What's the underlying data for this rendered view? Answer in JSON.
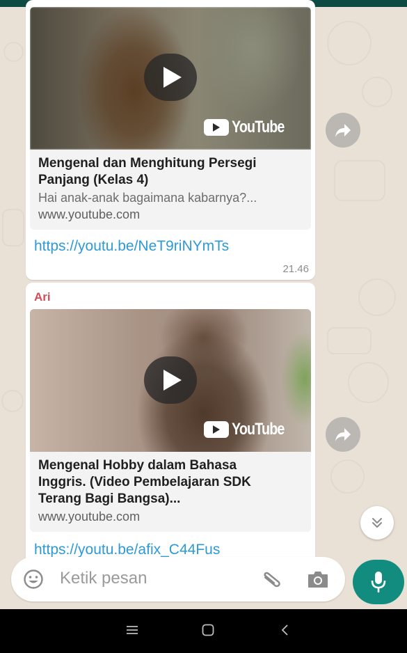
{
  "messages": [
    {
      "sender": "",
      "preview": {
        "title": "Mengenal dan Menghitung Persegi Panjang (Kelas 4)",
        "description": "Hai anak-anak bagaimana kabarnya?...",
        "domain": "www.youtube.com",
        "brand": "YouTube"
      },
      "link": "https://youtu.be/NeT9riNYmTs",
      "time": "21.46"
    },
    {
      "sender": "Ari",
      "preview": {
        "title": "Mengenal Hobby dalam Bahasa Inggris. (Video Pembelajaran SDK Terang Bagi Bangsa)...",
        "domain": "www.youtube.com",
        "brand": "YouTube"
      },
      "link": "https://youtu.be/afix_C44Fus"
    }
  ],
  "input": {
    "placeholder": "Ketik pesan"
  },
  "icons": {
    "emoji": "emoji-icon",
    "attach": "paperclip-icon",
    "camera": "camera-icon",
    "mic": "microphone-icon",
    "forward": "forward-icon",
    "scroll": "double-chevron-down-icon"
  },
  "colors": {
    "accent": "#128c7e",
    "link": "#2d9ad6",
    "sender": "#d24d57",
    "chat_background": "#e9e1d6"
  }
}
